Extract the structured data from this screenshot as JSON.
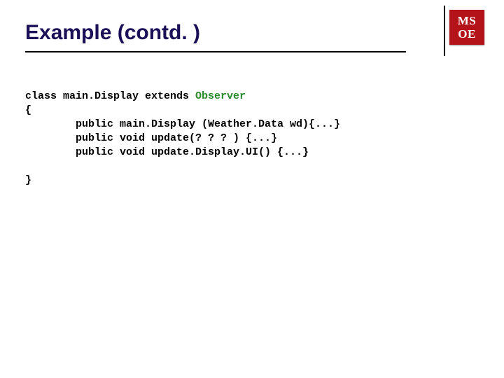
{
  "logo": {
    "line1": "MS",
    "line2": "OE"
  },
  "title": "Example (contd. )",
  "code": {
    "l1a": "class main.Display extends ",
    "l1b": "Observer",
    "l2": "{",
    "l3": "public main.Display (Weather.Data wd){...}",
    "l4": "public void update(? ? ? ) {...}",
    "l5": "public void update.Display.UI() {...}",
    "l6": "}"
  }
}
